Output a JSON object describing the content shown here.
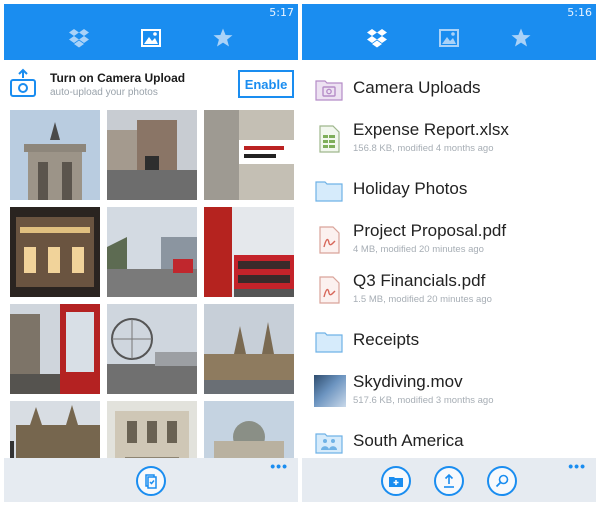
{
  "left": {
    "status_time": "5:17",
    "tabs": [
      {
        "icon": "dropbox-icon",
        "active": false
      },
      {
        "icon": "photos-icon",
        "active": true
      },
      {
        "icon": "star-icon",
        "active": false
      }
    ],
    "banner": {
      "title": "Turn on Camera Upload",
      "subtitle": "auto-upload your photos",
      "enable_label": "Enable"
    },
    "more_label": "•••"
  },
  "right": {
    "status_time": "5:16",
    "tabs": [
      {
        "icon": "dropbox-icon",
        "active": true
      },
      {
        "icon": "photos-icon",
        "active": false
      },
      {
        "icon": "star-icon",
        "active": false
      }
    ],
    "files": [
      {
        "name": "Camera Uploads",
        "meta": "",
        "icon": "camera-folder-icon"
      },
      {
        "name": "Expense Report.xlsx",
        "meta": "156.8 KB, modified 4 months ago",
        "icon": "spreadsheet-file-icon"
      },
      {
        "name": "Holiday Photos",
        "meta": "",
        "icon": "folder-icon"
      },
      {
        "name": "Project Proposal.pdf",
        "meta": "4 MB, modified 20 minutes ago",
        "icon": "pdf-file-icon"
      },
      {
        "name": "Q3 Financials.pdf",
        "meta": "1.5 MB, modified 20 minutes ago",
        "icon": "pdf-file-icon"
      },
      {
        "name": "Receipts",
        "meta": "",
        "icon": "folder-icon"
      },
      {
        "name": "Skydiving.mov",
        "meta": "517.6 KB, modified 3 months ago",
        "icon": "video-thumbnail"
      },
      {
        "name": "South America",
        "meta": "",
        "icon": "shared-folder-icon"
      }
    ],
    "more_label": "•••"
  },
  "colors": {
    "accent": "#1a8df0",
    "appbar": "#e6ebf1",
    "meta_text": "#a7aeb5"
  }
}
